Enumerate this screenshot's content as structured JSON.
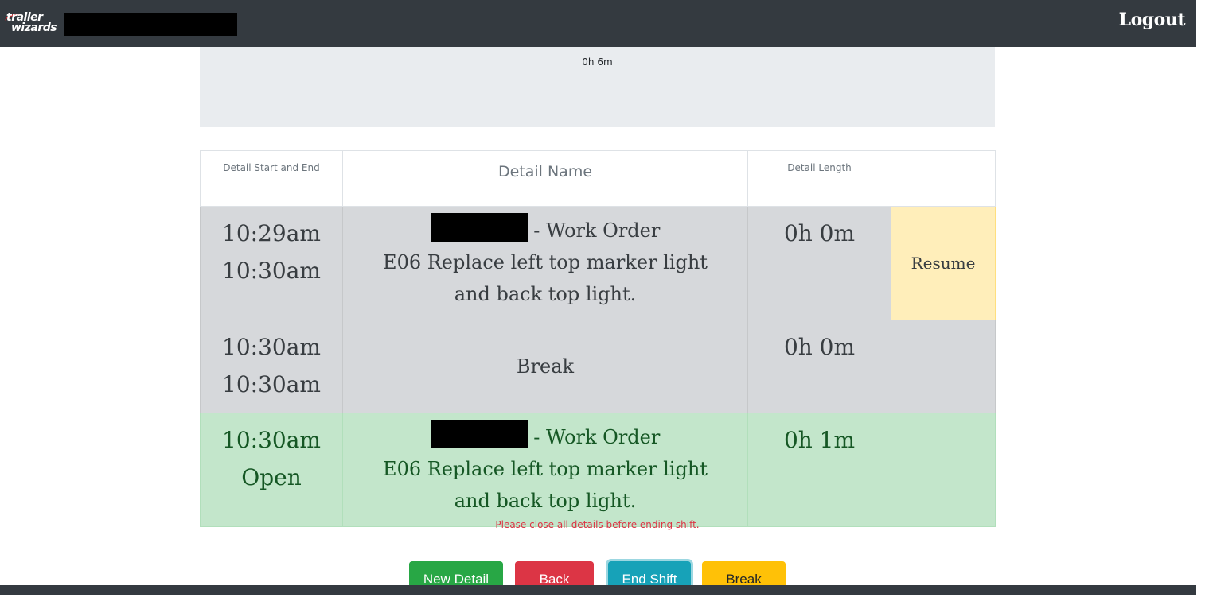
{
  "navbar": {
    "logo_line1": "trailer",
    "logo_line2": "wizards",
    "logout_label": "Logout"
  },
  "summary": {
    "total_duration": "0h 6m"
  },
  "table": {
    "headers": [
      "Detail Start and End",
      "Detail Name",
      "Detail Length",
      ""
    ],
    "rows": [
      {
        "start": "10:29am",
        "end": "10:30am",
        "name_suffix": " - Work Order",
        "description": "E06 Replace left top marker light and back top light.",
        "length": "0h 0m",
        "action": "Resume"
      },
      {
        "start": "10:30am",
        "end": "10:30am",
        "name": "Break",
        "length": "0h 0m",
        "action": ""
      },
      {
        "start": "10:30am",
        "end": "Open",
        "name_suffix": " - Work Order",
        "description": "E06 Replace left top marker light and back top light.",
        "length": "0h 1m",
        "action": ""
      }
    ]
  },
  "error_message": "Please close all details before ending shift.",
  "buttons": {
    "new_detail": "New Detail",
    "back": "Back",
    "end_shift": "End Shift",
    "break": "Break"
  },
  "colors": {
    "navbar": "#343a40",
    "row_gray": "#d6d8db",
    "row_green": "#c3e6cb",
    "resume": "#ffeeba",
    "new_detail": "#28a745",
    "back": "#dc3545",
    "end_shift": "#17a2b8",
    "break": "#ffc107"
  }
}
